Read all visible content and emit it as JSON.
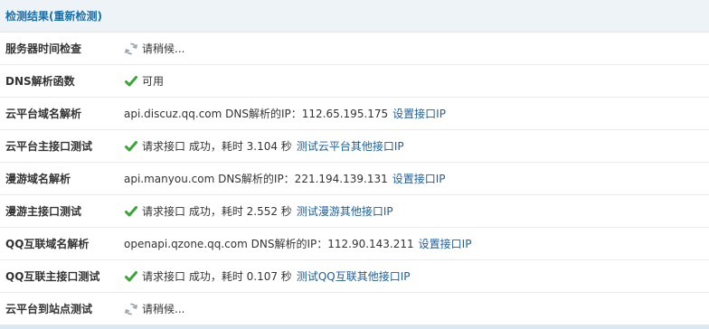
{
  "header": {
    "title": "检测结果(重新检测)"
  },
  "rows": [
    {
      "label": "服务器时间检查",
      "icon": "loading-spinner-icon",
      "text": "请稍候...",
      "link": ""
    },
    {
      "label": "DNS解析函数",
      "icon": "check-icon",
      "text": "可用",
      "link": ""
    },
    {
      "label": "云平台域名解析",
      "icon": "",
      "text": "api.discuz.qq.com DNS解析的IP：112.65.195.175",
      "link": "设置接口IP"
    },
    {
      "label": "云平台主接口测试",
      "icon": "check-icon",
      "text": "请求接口 成功，耗时 3.104 秒",
      "link": "测试云平台其他接口IP"
    },
    {
      "label": "漫游域名解析",
      "icon": "",
      "text": "api.manyou.com DNS解析的IP：221.194.139.131",
      "link": "设置接口IP"
    },
    {
      "label": "漫游主接口测试",
      "icon": "check-icon",
      "text": "请求接口 成功，耗时 2.552 秒",
      "link": "测试漫游其他接口IP"
    },
    {
      "label": "QQ互联域名解析",
      "icon": "",
      "text": "openapi.qzone.qq.com DNS解析的IP：112.90.143.211",
      "link": "设置接口IP"
    },
    {
      "label": "QQ互联主接口测试",
      "icon": "check-icon",
      "text": "请求接口 成功，耗时 0.107 秒",
      "link": "测试QQ互联其他接口IP"
    },
    {
      "label": "云平台到站点测试",
      "icon": "loading-spinner-icon",
      "text": "请稍候...",
      "link": ""
    }
  ],
  "colors": {
    "accent": "#1a6ea8",
    "link": "#1f5d9c",
    "success": "#3aa63a",
    "header_bg": "#eef3f8"
  }
}
